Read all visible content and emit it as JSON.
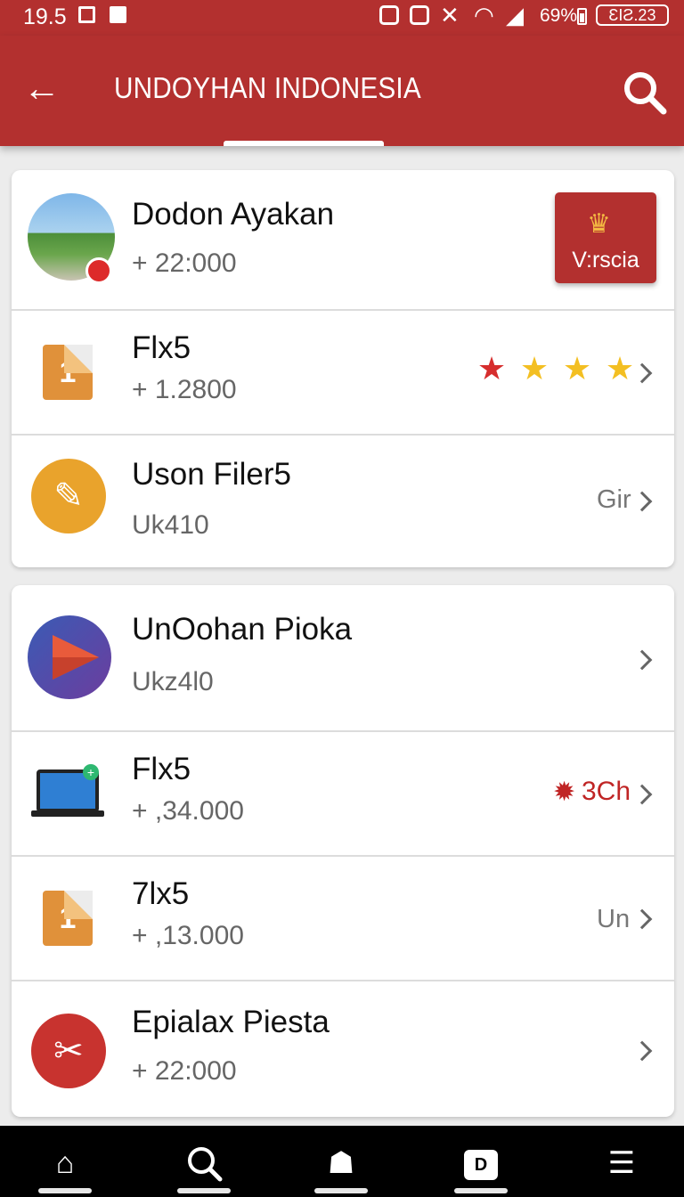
{
  "status": {
    "time": "19.5",
    "battery": "69%",
    "clock_box": "ƐIƧ.23"
  },
  "header": {
    "title": "UNDOYHAN INDONESIA"
  },
  "group1": [
    {
      "name": "Dodon Ayakan",
      "sub": "+ 22:000",
      "action": "V:rscia"
    },
    {
      "name": "Flx5",
      "sub": "+ 1.2800",
      "rating": 4
    },
    {
      "name": "Uson Filer5",
      "sub": "Uk410",
      "side": "Gir"
    }
  ],
  "group2": [
    {
      "name": "UnOohan Pioka",
      "sub": "Ukz4l0"
    },
    {
      "name": "Flx5",
      "sub": "+ ,34.000",
      "side": "3Ch"
    },
    {
      "name": "7lx5",
      "sub": "+ ,13.000",
      "side": "Un"
    },
    {
      "name": "Epialax Piesta",
      "sub": "+ 22:000"
    }
  ],
  "icons": {
    "back": "arrow-left",
    "search": "search",
    "nav": [
      "home",
      "search",
      "house",
      "d-square",
      "menu"
    ]
  },
  "colors": {
    "primary": "#b3302f",
    "star_red": "#d62d2d",
    "star_yellow": "#f3bf22"
  }
}
